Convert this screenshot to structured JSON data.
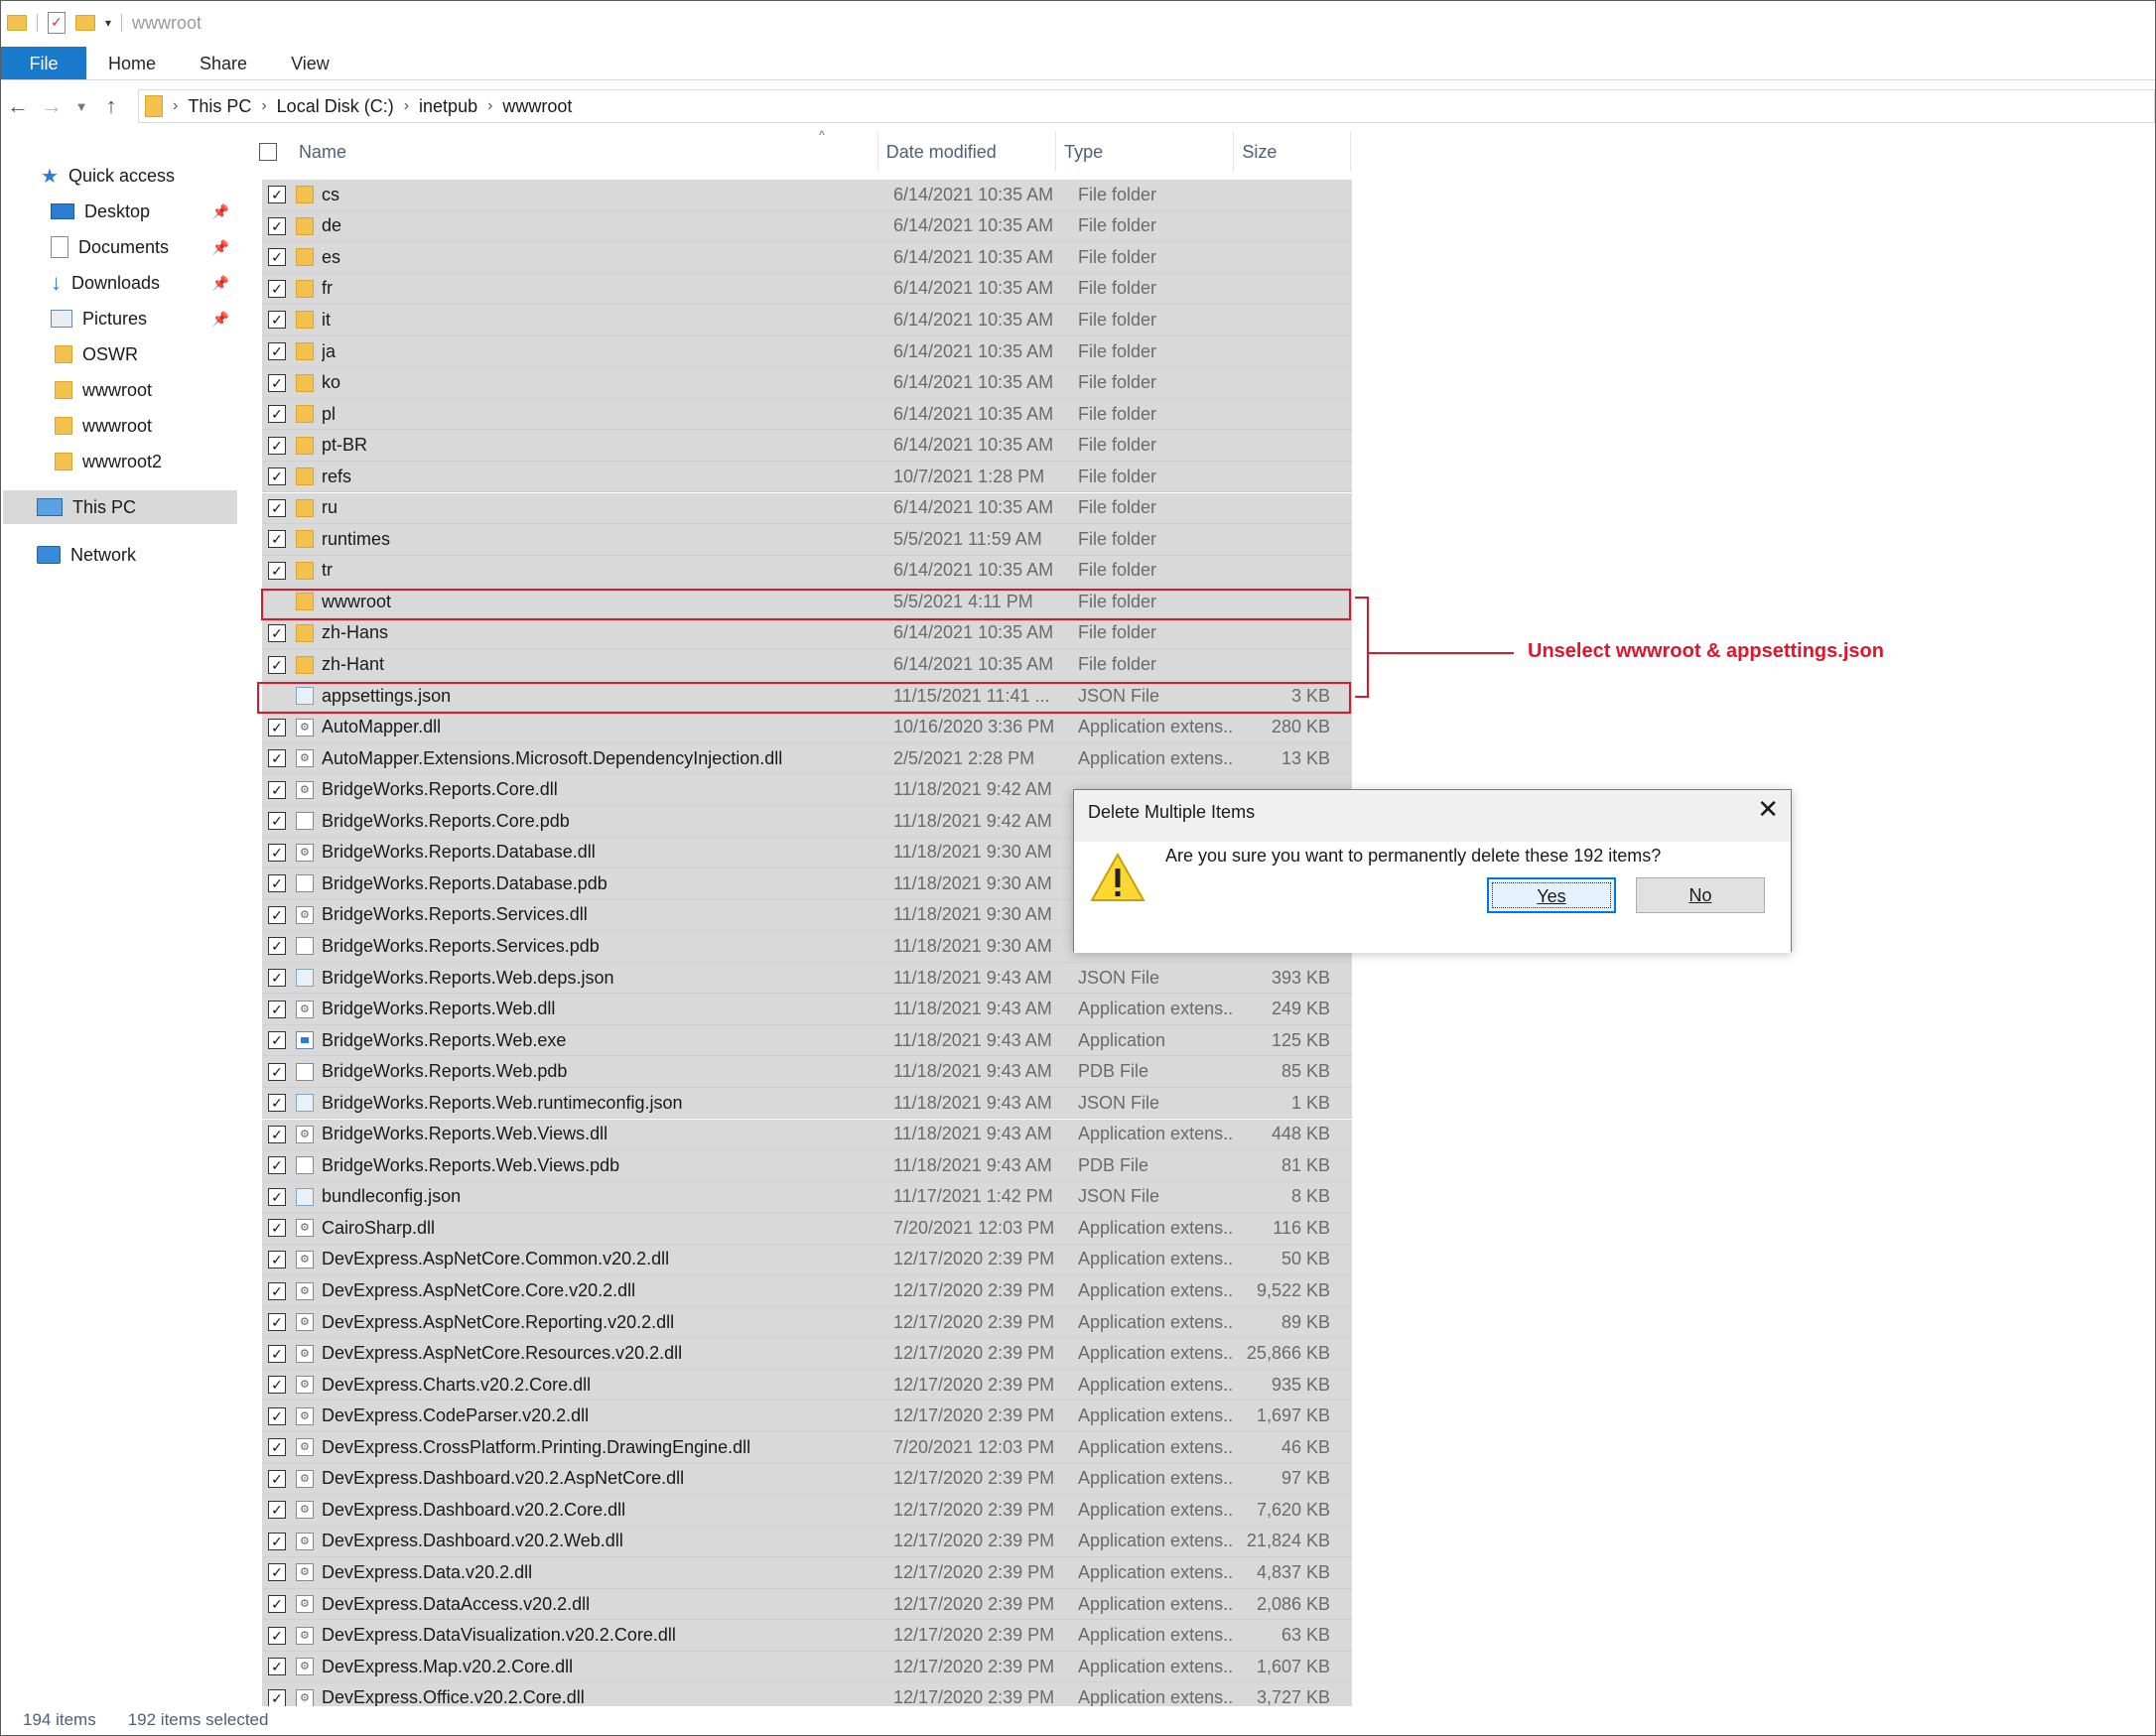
{
  "window": {
    "title": "wwwroot"
  },
  "ribbon": {
    "tabs": [
      "File",
      "Home",
      "Share",
      "View"
    ]
  },
  "address": {
    "crumbs": [
      "This PC",
      "Local Disk (C:)",
      "inetpub",
      "wwwroot"
    ]
  },
  "nav": {
    "items": [
      {
        "label": "Quick access",
        "icon": "star-icon",
        "pinned": false
      },
      {
        "label": "Desktop",
        "icon": "desktop-icon",
        "pinned": true
      },
      {
        "label": "Documents",
        "icon": "documents-icon",
        "pinned": true
      },
      {
        "label": "Downloads",
        "icon": "downloads-icon",
        "pinned": true
      },
      {
        "label": "Pictures",
        "icon": "pictures-icon",
        "pinned": true
      },
      {
        "label": "OSWR",
        "icon": "folder-icon",
        "pinned": false
      },
      {
        "label": "wwwroot",
        "icon": "folder-icon",
        "pinned": false
      },
      {
        "label": "wwwroot",
        "icon": "folder-icon",
        "pinned": false
      },
      {
        "label": "wwwroot2",
        "icon": "folder-icon",
        "pinned": false
      },
      {
        "label": "This PC",
        "icon": "this-pc-icon",
        "pinned": false
      },
      {
        "label": "Network",
        "icon": "network-icon",
        "pinned": false
      }
    ]
  },
  "columns": {
    "name": "Name",
    "date": "Date modified",
    "type": "Type",
    "size": "Size"
  },
  "files": [
    {
      "name": "cs",
      "date": "6/14/2021 10:35 AM",
      "type": "File folder",
      "size": "",
      "icon": "folder",
      "checked": true
    },
    {
      "name": "de",
      "date": "6/14/2021 10:35 AM",
      "type": "File folder",
      "size": "",
      "icon": "folder",
      "checked": true
    },
    {
      "name": "es",
      "date": "6/14/2021 10:35 AM",
      "type": "File folder",
      "size": "",
      "icon": "folder",
      "checked": true
    },
    {
      "name": "fr",
      "date": "6/14/2021 10:35 AM",
      "type": "File folder",
      "size": "",
      "icon": "folder",
      "checked": true
    },
    {
      "name": "it",
      "date": "6/14/2021 10:35 AM",
      "type": "File folder",
      "size": "",
      "icon": "folder",
      "checked": true
    },
    {
      "name": "ja",
      "date": "6/14/2021 10:35 AM",
      "type": "File folder",
      "size": "",
      "icon": "folder",
      "checked": true
    },
    {
      "name": "ko",
      "date": "6/14/2021 10:35 AM",
      "type": "File folder",
      "size": "",
      "icon": "folder",
      "checked": true
    },
    {
      "name": "pl",
      "date": "6/14/2021 10:35 AM",
      "type": "File folder",
      "size": "",
      "icon": "folder",
      "checked": true
    },
    {
      "name": "pt-BR",
      "date": "6/14/2021 10:35 AM",
      "type": "File folder",
      "size": "",
      "icon": "folder",
      "checked": true
    },
    {
      "name": "refs",
      "date": "10/7/2021 1:28 PM",
      "type": "File folder",
      "size": "",
      "icon": "folder",
      "checked": true
    },
    {
      "name": "ru",
      "date": "6/14/2021 10:35 AM",
      "type": "File folder",
      "size": "",
      "icon": "folder",
      "checked": true
    },
    {
      "name": "runtimes",
      "date": "5/5/2021 11:59 AM",
      "type": "File folder",
      "size": "",
      "icon": "folder",
      "checked": true
    },
    {
      "name": "tr",
      "date": "6/14/2021 10:35 AM",
      "type": "File folder",
      "size": "",
      "icon": "folder",
      "checked": true
    },
    {
      "name": "wwwroot",
      "date": "5/5/2021 4:11 PM",
      "type": "File folder",
      "size": "",
      "icon": "folder",
      "checked": false
    },
    {
      "name": "zh-Hans",
      "date": "6/14/2021 10:35 AM",
      "type": "File folder",
      "size": "",
      "icon": "folder",
      "checked": true
    },
    {
      "name": "zh-Hant",
      "date": "6/14/2021 10:35 AM",
      "type": "File folder",
      "size": "",
      "icon": "folder",
      "checked": true
    },
    {
      "name": "appsettings.json",
      "date": "11/15/2021 11:41 ...",
      "type": "JSON File",
      "size": "3 KB",
      "icon": "json",
      "checked": false
    },
    {
      "name": "AutoMapper.dll",
      "date": "10/16/2020 3:36 PM",
      "type": "Application extens...",
      "size": "280 KB",
      "icon": "dll",
      "checked": true
    },
    {
      "name": "AutoMapper.Extensions.Microsoft.DependencyInjection.dll",
      "date": "2/5/2021 2:28 PM",
      "type": "Application extens...",
      "size": "13 KB",
      "icon": "dll",
      "checked": true
    },
    {
      "name": "BridgeWorks.Reports.Core.dll",
      "date": "11/18/2021 9:42 AM",
      "type": "",
      "size": "",
      "icon": "dll",
      "checked": true
    },
    {
      "name": "BridgeWorks.Reports.Core.pdb",
      "date": "11/18/2021 9:42 AM",
      "type": "",
      "size": "",
      "icon": "pdb",
      "checked": true
    },
    {
      "name": "BridgeWorks.Reports.Database.dll",
      "date": "11/18/2021 9:30 AM",
      "type": "",
      "size": "",
      "icon": "dll",
      "checked": true
    },
    {
      "name": "BridgeWorks.Reports.Database.pdb",
      "date": "11/18/2021 9:30 AM",
      "type": "",
      "size": "",
      "icon": "pdb",
      "checked": true
    },
    {
      "name": "BridgeWorks.Reports.Services.dll",
      "date": "11/18/2021 9:30 AM",
      "type": "",
      "size": "",
      "icon": "dll",
      "checked": true
    },
    {
      "name": "BridgeWorks.Reports.Services.pdb",
      "date": "11/18/2021 9:30 AM",
      "type": "",
      "size": "",
      "icon": "pdb",
      "checked": true
    },
    {
      "name": "BridgeWorks.Reports.Web.deps.json",
      "date": "11/18/2021 9:43 AM",
      "type": "JSON File",
      "size": "393 KB",
      "icon": "json",
      "checked": true
    },
    {
      "name": "BridgeWorks.Reports.Web.dll",
      "date": "11/18/2021 9:43 AM",
      "type": "Application extens...",
      "size": "249 KB",
      "icon": "dll",
      "checked": true
    },
    {
      "name": "BridgeWorks.Reports.Web.exe",
      "date": "11/18/2021 9:43 AM",
      "type": "Application",
      "size": "125 KB",
      "icon": "exe",
      "checked": true
    },
    {
      "name": "BridgeWorks.Reports.Web.pdb",
      "date": "11/18/2021 9:43 AM",
      "type": "PDB File",
      "size": "85 KB",
      "icon": "pdb",
      "checked": true
    },
    {
      "name": "BridgeWorks.Reports.Web.runtimeconfig.json",
      "date": "11/18/2021 9:43 AM",
      "type": "JSON File",
      "size": "1 KB",
      "icon": "json",
      "checked": true
    },
    {
      "name": "BridgeWorks.Reports.Web.Views.dll",
      "date": "11/18/2021 9:43 AM",
      "type": "Application extens...",
      "size": "448 KB",
      "icon": "dll",
      "checked": true
    },
    {
      "name": "BridgeWorks.Reports.Web.Views.pdb",
      "date": "11/18/2021 9:43 AM",
      "type": "PDB File",
      "size": "81 KB",
      "icon": "pdb",
      "checked": true
    },
    {
      "name": "bundleconfig.json",
      "date": "11/17/2021 1:42 PM",
      "type": "JSON File",
      "size": "8 KB",
      "icon": "json",
      "checked": true
    },
    {
      "name": "CairoSharp.dll",
      "date": "7/20/2021 12:03 PM",
      "type": "Application extens...",
      "size": "116 KB",
      "icon": "dll",
      "checked": true
    },
    {
      "name": "DevExpress.AspNetCore.Common.v20.2.dll",
      "date": "12/17/2020 2:39 PM",
      "type": "Application extens...",
      "size": "50 KB",
      "icon": "dll",
      "checked": true
    },
    {
      "name": "DevExpress.AspNetCore.Core.v20.2.dll",
      "date": "12/17/2020 2:39 PM",
      "type": "Application extens...",
      "size": "9,522 KB",
      "icon": "dll",
      "checked": true
    },
    {
      "name": "DevExpress.AspNetCore.Reporting.v20.2.dll",
      "date": "12/17/2020 2:39 PM",
      "type": "Application extens...",
      "size": "89 KB",
      "icon": "dll",
      "checked": true
    },
    {
      "name": "DevExpress.AspNetCore.Resources.v20.2.dll",
      "date": "12/17/2020 2:39 PM",
      "type": "Application extens...",
      "size": "25,866 KB",
      "icon": "dll",
      "checked": true
    },
    {
      "name": "DevExpress.Charts.v20.2.Core.dll",
      "date": "12/17/2020 2:39 PM",
      "type": "Application extens...",
      "size": "935 KB",
      "icon": "dll",
      "checked": true
    },
    {
      "name": "DevExpress.CodeParser.v20.2.dll",
      "date": "12/17/2020 2:39 PM",
      "type": "Application extens...",
      "size": "1,697 KB",
      "icon": "dll",
      "checked": true
    },
    {
      "name": "DevExpress.CrossPlatform.Printing.DrawingEngine.dll",
      "date": "7/20/2021 12:03 PM",
      "type": "Application extens...",
      "size": "46 KB",
      "icon": "dll",
      "checked": true
    },
    {
      "name": "DevExpress.Dashboard.v20.2.AspNetCore.dll",
      "date": "12/17/2020 2:39 PM",
      "type": "Application extens...",
      "size": "97 KB",
      "icon": "dll",
      "checked": true
    },
    {
      "name": "DevExpress.Dashboard.v20.2.Core.dll",
      "date": "12/17/2020 2:39 PM",
      "type": "Application extens...",
      "size": "7,620 KB",
      "icon": "dll",
      "checked": true
    },
    {
      "name": "DevExpress.Dashboard.v20.2.Web.dll",
      "date": "12/17/2020 2:39 PM",
      "type": "Application extens...",
      "size": "21,824 KB",
      "icon": "dll",
      "checked": true
    },
    {
      "name": "DevExpress.Data.v20.2.dll",
      "date": "12/17/2020 2:39 PM",
      "type": "Application extens...",
      "size": "4,837 KB",
      "icon": "dll",
      "checked": true
    },
    {
      "name": "DevExpress.DataAccess.v20.2.dll",
      "date": "12/17/2020 2:39 PM",
      "type": "Application extens...",
      "size": "2,086 KB",
      "icon": "dll",
      "checked": true
    },
    {
      "name": "DevExpress.DataVisualization.v20.2.Core.dll",
      "date": "12/17/2020 2:39 PM",
      "type": "Application extens...",
      "size": "63 KB",
      "icon": "dll",
      "checked": true
    },
    {
      "name": "DevExpress.Map.v20.2.Core.dll",
      "date": "12/17/2020 2:39 PM",
      "type": "Application extens...",
      "size": "1,607 KB",
      "icon": "dll",
      "checked": true
    },
    {
      "name": "DevExpress.Office.v20.2.Core.dll",
      "date": "12/17/2020 2:39 PM",
      "type": "Application extens...",
      "size": "3,727 KB",
      "icon": "dll",
      "checked": true
    }
  ],
  "status": {
    "count": "194 items",
    "selected": "192 items selected"
  },
  "dialog": {
    "title": "Delete Multiple Items",
    "message": "Are you sure you want to permanently delete these 192 items?",
    "yes_label": "Yes",
    "no_label": "No",
    "close_glyph": "✕"
  },
  "annotation": {
    "text": "Unselect wwwroot & appsettings.json",
    "color": "#e0152b"
  },
  "colors": {
    "accent": "#1979ca",
    "selection": "#d9d9d9",
    "folder": "#f2c14e"
  }
}
